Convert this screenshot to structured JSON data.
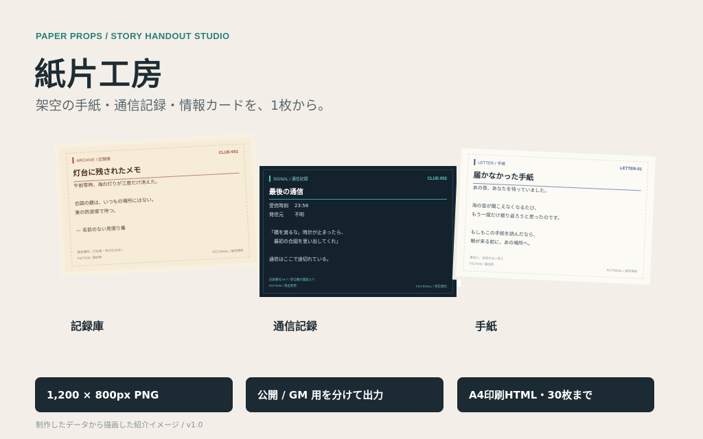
{
  "header": {
    "eyebrow": "PAPER PROPS / STORY HANDOUT STUDIO",
    "title": "紙片工房",
    "subtitle": "架空の手紙・通信記録・情報カードを、1枚から。"
  },
  "cards": {
    "archive": {
      "tag": "ARCHIVE / 記録庫",
      "id": "CLUE-001",
      "title": "灯台に残されたメモ",
      "lines": [
        "午前零時、海の灯りが三度だけ消えた。",
        "",
        "合図の鍵は、いつもの場所にはない。",
        "東の防波堤で待つ。",
        "",
        "— 名前のない見張り番"
      ],
      "footer_left": [
        "発見場所：灯台室・机の引き出し",
        "FICTION / 演出用"
      ],
      "footer_right": "FICTIONAL / 架空資料"
    },
    "signal": {
      "tag": "SIGNAL / 通信記録",
      "id": "CLUE-002",
      "title": "最後の通信",
      "rows": [
        {
          "k": "受信時刻",
          "v": "23:58"
        },
        {
          "k": "発信元",
          "v": "不明"
        }
      ],
      "quote": [
        "「橋を渡るな。時計が止まったら、",
        "　最初の合図を思い出してくれ」"
      ],
      "closing": "通信はここで途切れている。",
      "footer_left": [
        "記録番号 M-7 / 受信機の履歴より",
        "FICTION / 演出専用"
      ],
      "footer_right": "FICTIONAL / 架空資料"
    },
    "letter": {
      "tag": "LETTER / 手紙",
      "id": "LETTER-01",
      "title": "届かなかった手紙",
      "lines": [
        "あの夜、あなたを待っていました。",
        "",
        "海の音が聞こえなくなるたび、",
        "もう一度だけ振り返ろうと思ったのです。",
        "",
        "もしもこの手紙を読んだなら、",
        "朝が来る前に、あの場所へ。"
      ],
      "footer_left": [
        "差出人：名前のない友人",
        "FICTION / 演出用"
      ],
      "footer_right": "FICTIONAL / 架空資料"
    }
  },
  "labels": {
    "archive": "記録庫",
    "signal": "通信記録",
    "letter": "手紙"
  },
  "features": [
    "1,200 × 800px PNG",
    "公開 / GM 用を分けて出力",
    "A4印刷HTML・30枚まで"
  ],
  "note": "制作したデータから描画した紹介イメージ / v1.0",
  "colors": {
    "background": "#f3efe8",
    "accent_teal": "#2a7f7a",
    "navy": "#1b2a33",
    "archive_red": "#b0473a",
    "signal_teal": "#3dc7b8",
    "letter_blue": "#3b5a9a"
  }
}
